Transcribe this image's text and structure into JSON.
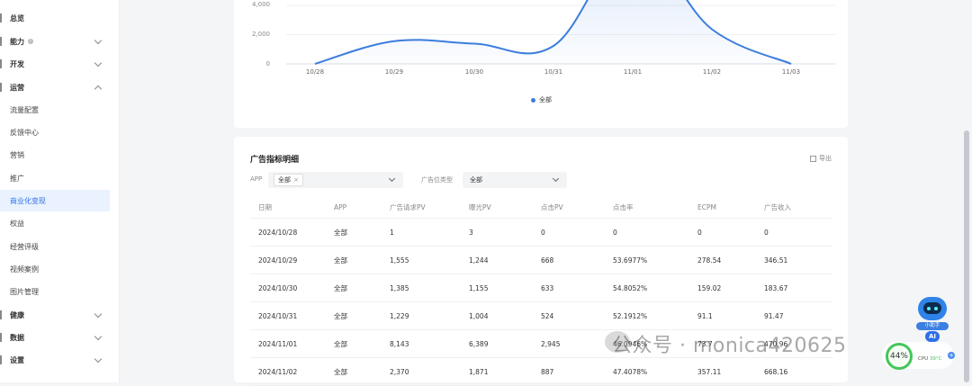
{
  "sidebar": {
    "items": [
      {
        "label": "总览",
        "kind": "group"
      },
      {
        "label": "能力",
        "kind": "group",
        "chevron": "down",
        "info": true
      },
      {
        "label": "开发",
        "kind": "group",
        "chevron": "down"
      },
      {
        "label": "运营",
        "kind": "group",
        "chevron": "up"
      },
      {
        "label": "流量配置",
        "kind": "sub"
      },
      {
        "label": "反馈中心",
        "kind": "sub"
      },
      {
        "label": "营销",
        "kind": "sub"
      },
      {
        "label": "推广",
        "kind": "sub"
      },
      {
        "label": "商业化变现",
        "kind": "sub",
        "active": true
      },
      {
        "label": "权益",
        "kind": "sub"
      },
      {
        "label": "经营评级",
        "kind": "sub"
      },
      {
        "label": "视频案例",
        "kind": "sub"
      },
      {
        "label": "图片管理",
        "kind": "sub"
      },
      {
        "label": "健康",
        "kind": "group",
        "chevron": "down"
      },
      {
        "label": "数据",
        "kind": "group",
        "chevron": "down"
      },
      {
        "label": "设置",
        "kind": "group",
        "chevron": "down"
      }
    ]
  },
  "chart_data": {
    "type": "line",
    "categories": [
      "10/28",
      "10/29",
      "10/30",
      "10/31",
      "11/01",
      "11/02",
      "11/03"
    ],
    "y_ticks": [
      "4,000",
      "2,000",
      "0"
    ],
    "series": [
      {
        "name": "全部",
        "values": [
          1,
          1555,
          1385,
          1229,
          8143,
          2370,
          0
        ],
        "color": "#3b7ddd"
      }
    ],
    "ylim": [
      0,
      5000
    ],
    "legend": "bottom",
    "grid": true
  },
  "table_card": {
    "title": "广告指标明细",
    "export_label": "导出",
    "filters": {
      "app_label": "APP",
      "app_tag": "全部",
      "tag_remove": "×",
      "ad_type_label": "广告位类型",
      "ad_type_value": "全部"
    },
    "columns": [
      "日期",
      "APP",
      "广告请求PV",
      "曝光PV",
      "点击PV",
      "点击率",
      "ECPM",
      "广告收入"
    ],
    "rows": [
      [
        "2024/10/28",
        "全部",
        "1",
        "3",
        "0",
        "0",
        "0",
        "0"
      ],
      [
        "2024/10/29",
        "全部",
        "1,555",
        "1,244",
        "668",
        "53.6977%",
        "278.54",
        "346.51"
      ],
      [
        "2024/10/30",
        "全部",
        "1,385",
        "1,155",
        "633",
        "54.8052%",
        "159.02",
        "183.67"
      ],
      [
        "2024/10/31",
        "全部",
        "1,229",
        "1,004",
        "524",
        "52.1912%",
        "91.1",
        "91.47"
      ],
      [
        "2024/11/01",
        "全部",
        "8,143",
        "6,389",
        "2,945",
        "46.0946%",
        "73.7",
        "470.96"
      ],
      [
        "2024/11/02",
        "全部",
        "2,370",
        "1,871",
        "887",
        "47.4078%",
        "357.11",
        "668.16"
      ]
    ]
  },
  "overlays": {
    "watermark": "公众号 · monica420625",
    "robot_caption": "小助手",
    "ai_badge": "AI",
    "cpu_percent": "44%",
    "cpu_label": "CPU",
    "cpu_temp": "39°C",
    "cpu_plus": "+"
  },
  "colors": {
    "accent": "#2f6fe8",
    "series": "#3b7ddd",
    "cpu_ring": "#45c55b"
  }
}
